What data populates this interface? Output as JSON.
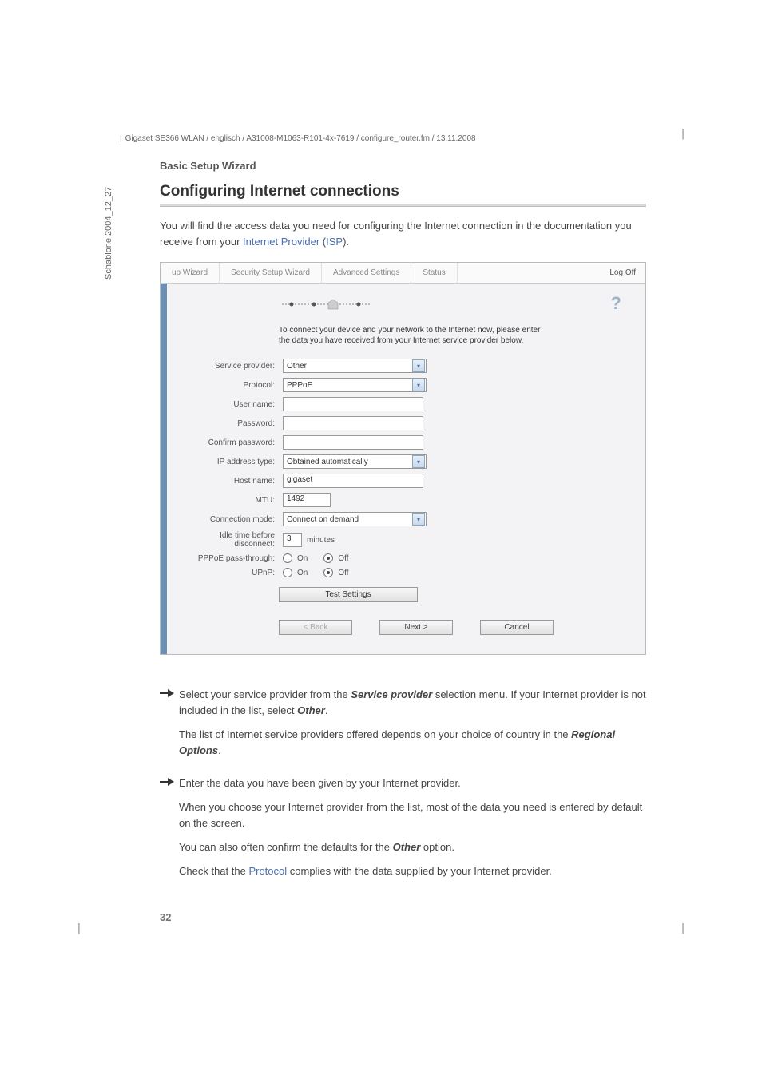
{
  "doc": {
    "header_path": "Gigaset SE366 WLAN / englisch / A31008-M1063-R101-4x-7619 / configure_router.fm / 13.11.2008",
    "sidebar_text": "Schablone 2004_12_27",
    "page_number": "32",
    "section_label": "Basic Setup Wizard",
    "title": "Configuring Internet connections",
    "intro_a": "You will find the access data you need for configuring the Internet connection in the documentation you receive from your ",
    "intro_link1": "Internet Provider",
    "intro_paren": " (",
    "intro_link2": "ISP",
    "intro_b": ")."
  },
  "screenshot": {
    "tabs": {
      "setup_wizard": "up Wizard",
      "security_setup": "Security Setup Wizard",
      "advanced": "Advanced Settings",
      "status": "Status"
    },
    "logoff": "Log Off",
    "help_icon": "?",
    "instruction": "To connect your device and your network to the Internet now, please enter the data you have received from your Internet service provider below.",
    "labels": {
      "service_provider": "Service provider:",
      "protocol": "Protocol:",
      "user_name": "User name:",
      "password": "Password:",
      "confirm_password": "Confirm password:",
      "ip_address_type": "IP address type:",
      "host_name": "Host name:",
      "mtu": "MTU:",
      "connection_mode": "Connection mode:",
      "idle_time": "Idle time before disconnect:",
      "pppoe_passthrough": "PPPoE pass-through:",
      "upnp": "UPnP:"
    },
    "values": {
      "service_provider": "Other",
      "protocol": "PPPoE",
      "user_name": "",
      "password": "",
      "confirm_password": "",
      "ip_address_type": "Obtained automatically",
      "host_name": "gigaset",
      "mtu": "1492",
      "connection_mode": "Connect on demand",
      "idle_time": "3",
      "idle_time_unit": "minutes"
    },
    "radios": {
      "on": "On",
      "off": "Off"
    },
    "buttons": {
      "test_settings": "Test Settings",
      "back": "< Back",
      "next": "Next >",
      "cancel": "Cancel"
    }
  },
  "instructions": {
    "i1a": "Select your service provider from the ",
    "i1_bold1": "Service provider",
    "i1b": " selection menu. If your Internet provider is not included in the list, select ",
    "i1_bold2": "Other",
    "i1c": ".",
    "i1_p2a": "The list of Internet service providers offered depends on your choice of country in the ",
    "i1_p2_bold": "Regional Options",
    "i1_p2b": ".",
    "i2": "Enter the data you have been given by your Internet provider.",
    "i2_p2": "When you choose your Internet provider from the list, most of the data you need is entered by default on the screen.",
    "i2_p3a": "You can also often confirm the defaults for the ",
    "i2_p3_bold": "Other",
    "i2_p3b": " option.",
    "i2_p4a": "Check that the ",
    "i2_p4_link": "Protocol",
    "i2_p4b": " complies with the data supplied by your Internet provider."
  }
}
